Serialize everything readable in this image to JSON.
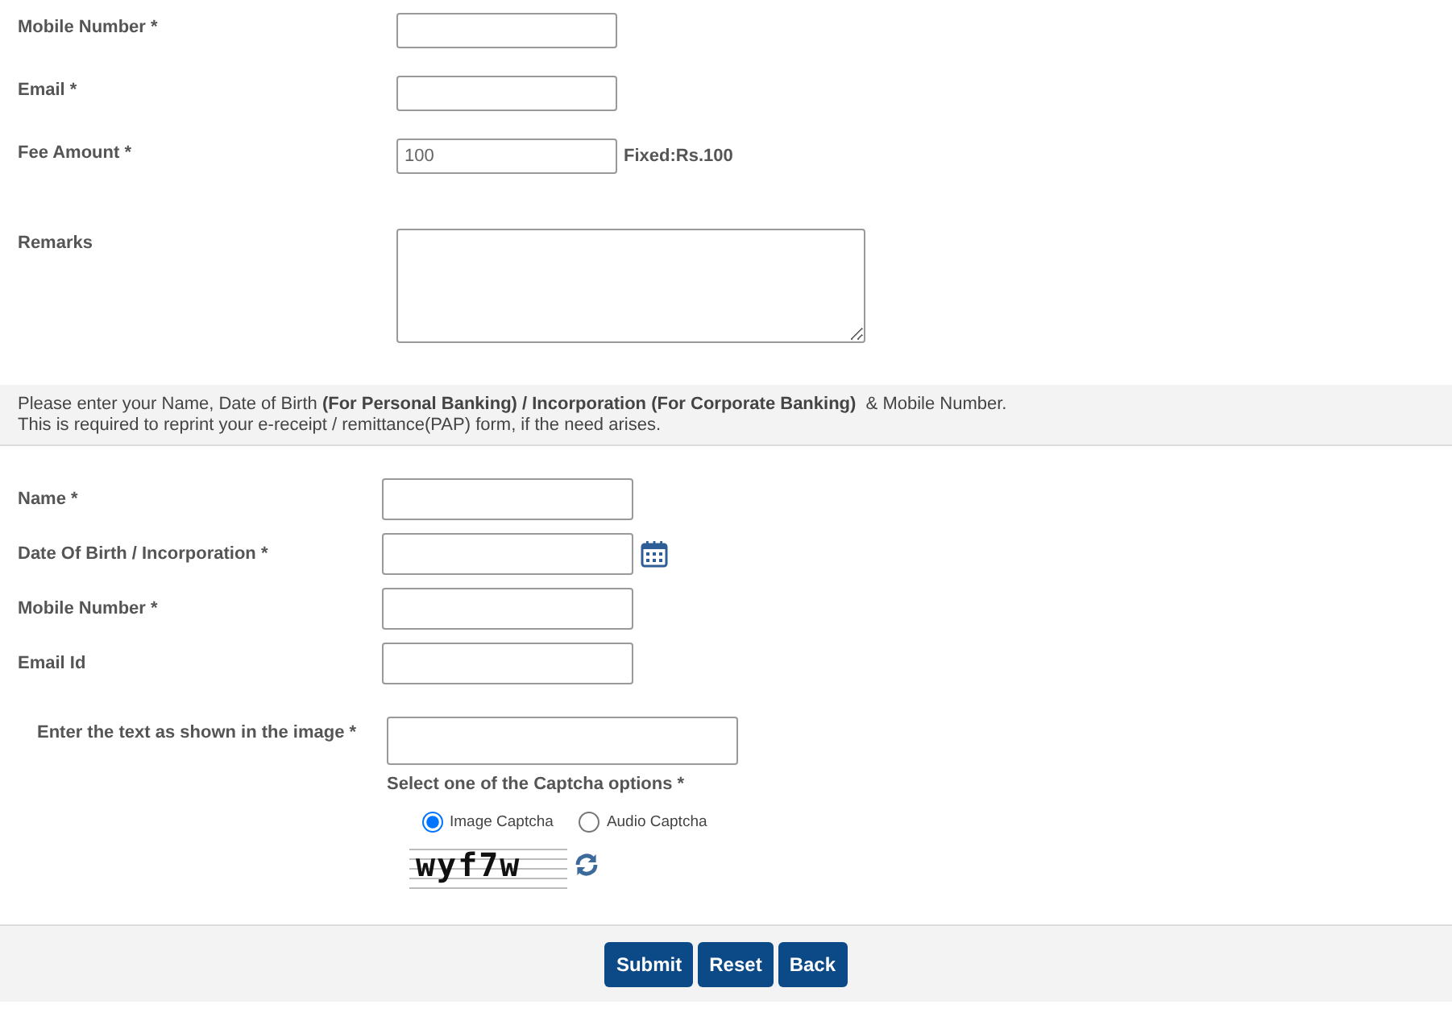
{
  "payment_fields": [
    {
      "label": "Mobile Number *",
      "kind": "input"
    },
    {
      "label": "Email *",
      "kind": "input"
    },
    {
      "label": "Fee Amount *",
      "kind": "input",
      "value": "100",
      "note": "Fixed:Rs.100"
    },
    {
      "label": "Remarks",
      "kind": "textarea"
    }
  ],
  "info": "Please enter your Name, Date of Birth **(For Personal Banking) / Incorporation (For Corporate Banking)**  & Mobile Number.",
  "info_line_2": "This is required to reprint your e-receipt / remittance(PAP) form, if the need arises.",
  "reprint_fields": [
    {
      "label": "Name *",
      "kind": "input"
    },
    {
      "label": "Date Of Birth / Incorporation *",
      "kind": "date"
    },
    {
      "label": "Mobile Number *",
      "kind": "input"
    },
    {
      "label": "Email Id",
      "kind": "input"
    }
  ],
  "captcha": {
    "label": "Enter the text as shown in the image *",
    "prompt": "Select one of the Captcha options *",
    "options": [
      {
        "label": "Image Captcha",
        "selected": true
      },
      {
        "label": "Audio Captcha",
        "selected": false
      }
    ],
    "code": "wyf7w"
  },
  "buttons": [
    "Submit",
    "Reset",
    "Back"
  ]
}
